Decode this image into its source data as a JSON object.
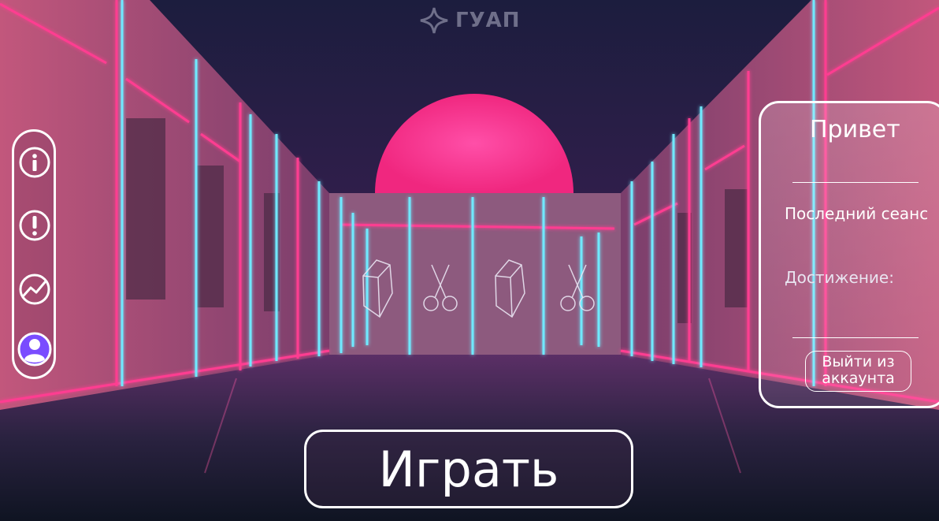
{
  "brand": {
    "logo_text": "ГУАП"
  },
  "sidebar": {
    "items": [
      {
        "name": "info",
        "icon": "info-icon"
      },
      {
        "name": "alert",
        "icon": "exclamation-icon"
      },
      {
        "name": "stats",
        "icon": "chart-trend-icon"
      },
      {
        "name": "profile",
        "icon": "user-icon",
        "active": true
      }
    ]
  },
  "profile_panel": {
    "greeting": "Привет",
    "last_session_label": "Последний сеанс",
    "achievement_label": "Достижение:",
    "logout_label": "Выйти из аккаунта"
  },
  "play_button": {
    "label": "Играть"
  },
  "colors": {
    "neon_pink": "#ff2e8a",
    "neon_cyan": "#58e6ff",
    "sky": "#1c1a3c",
    "active_profile": "#7a4cff"
  }
}
